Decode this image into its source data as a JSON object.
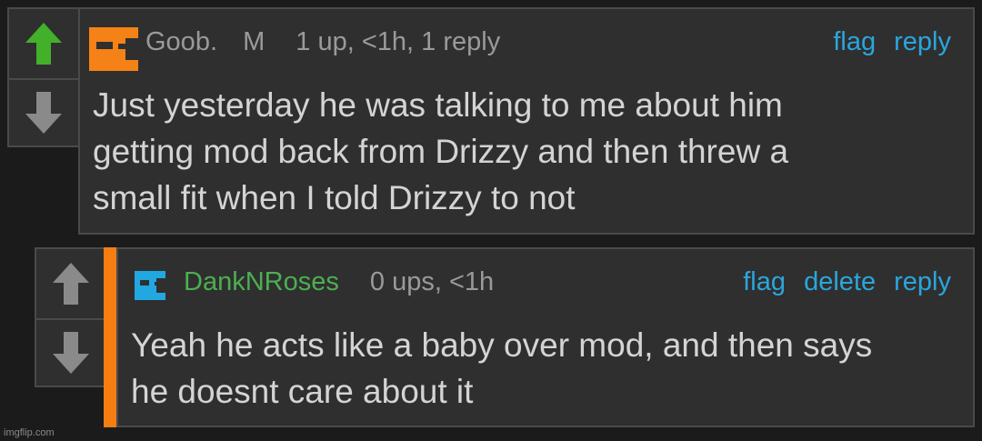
{
  "comments": [
    {
      "username": "Goob.",
      "badge": "M",
      "stats": "1 up, <1h, 1 reply",
      "actions": [
        "flag",
        "reply"
      ],
      "body": "Just yesterday he was talking to me about him\ngetting mod back from Drizzy and then threw a\nsmall fit when I told Drizzy to not",
      "avatar_color": "#f58216",
      "upvoted": true
    },
    {
      "username": "DankNRoses",
      "stats": "0 ups, <1h",
      "actions": [
        "flag",
        "delete",
        "reply"
      ],
      "body": "Yeah he acts like a baby over mod, and then says\nhe doesnt care about it",
      "avatar_color": "#22a8e0",
      "username_color": "#4caf50",
      "accent_color": "#f57d12",
      "upvoted": false
    }
  ],
  "watermark": "imgflip.com",
  "colors": {
    "upvote_active": "#43b02a",
    "arrow_inactive": "#8a8a8a",
    "link": "#2aa6dd"
  },
  "icons": [
    "up-arrow-icon",
    "down-arrow-icon",
    "avatar-icon"
  ]
}
